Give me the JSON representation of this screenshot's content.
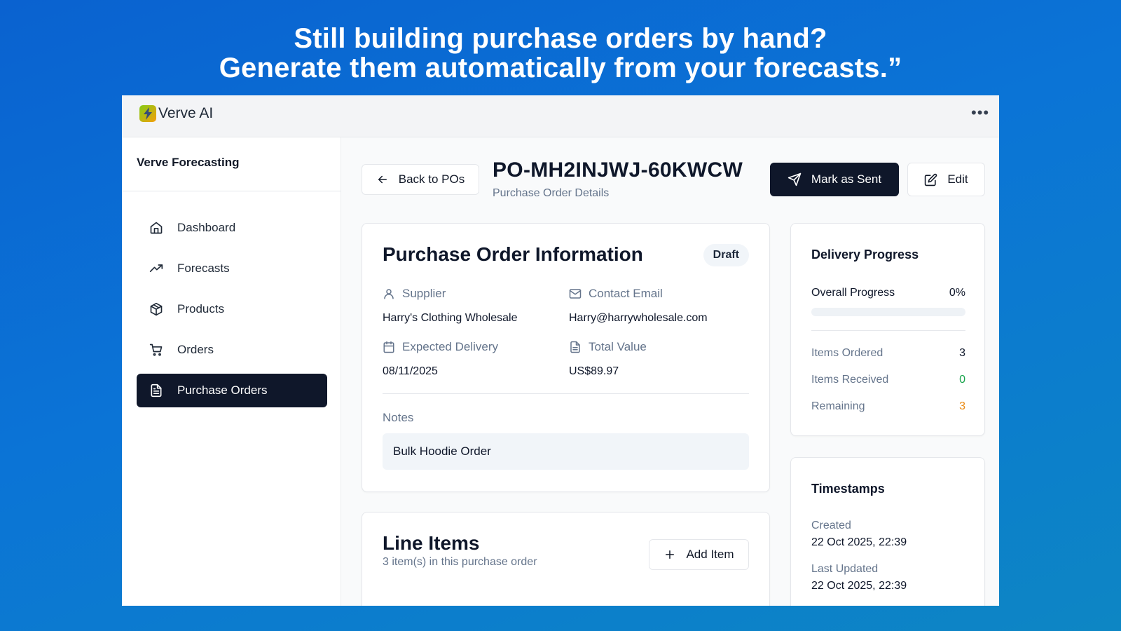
{
  "headline": {
    "line1": "Still building purchase orders by hand?",
    "line2": "Generate them automatically from your forecasts.”"
  },
  "app": {
    "brand": "Verve AI",
    "more_icon": "more-horizontal-icon"
  },
  "sidebar": {
    "title": "Verve Forecasting",
    "items": [
      {
        "label": "Dashboard",
        "icon": "home-icon"
      },
      {
        "label": "Forecasts",
        "icon": "trending-up-icon"
      },
      {
        "label": "Products",
        "icon": "package-icon"
      },
      {
        "label": "Orders",
        "icon": "cart-icon"
      },
      {
        "label": "Purchase Orders",
        "icon": "file-text-icon",
        "active": true
      }
    ]
  },
  "header": {
    "back_label": "Back to POs",
    "po_number": "PO-MH2INJWJ-60KWCW",
    "subtitle": "Purchase Order Details",
    "mark_sent_label": "Mark as Sent",
    "edit_label": "Edit"
  },
  "info": {
    "title": "Purchase Order Information",
    "status": "Draft",
    "supplier_label": "Supplier",
    "supplier": "Harry's Clothing Wholesale",
    "email_label": "Contact Email",
    "email": "Harry@harrywholesale.com",
    "delivery_label": "Expected Delivery",
    "delivery": "08/11/2025",
    "total_label": "Total Value",
    "total": "US$89.97",
    "notes_label": "Notes",
    "notes": "Bulk Hoodie Order"
  },
  "line_items": {
    "title": "Line Items",
    "subtitle": "3 item(s) in this purchase order",
    "add_label": "Add Item"
  },
  "delivery": {
    "title": "Delivery Progress",
    "overall_label": "Overall Progress",
    "overall_value": "0%",
    "progress": 0,
    "ordered_label": "Items Ordered",
    "ordered": "3",
    "received_label": "Items Received",
    "received": "0",
    "remaining_label": "Remaining",
    "remaining": "3",
    "colors": {
      "received": "#16a34a",
      "remaining": "#ea8a12"
    }
  },
  "timestamps": {
    "title": "Timestamps",
    "created_label": "Created",
    "created": "22 Oct 2025, 22:39",
    "updated_label": "Last Updated",
    "updated": "22 Oct 2025, 22:39"
  }
}
